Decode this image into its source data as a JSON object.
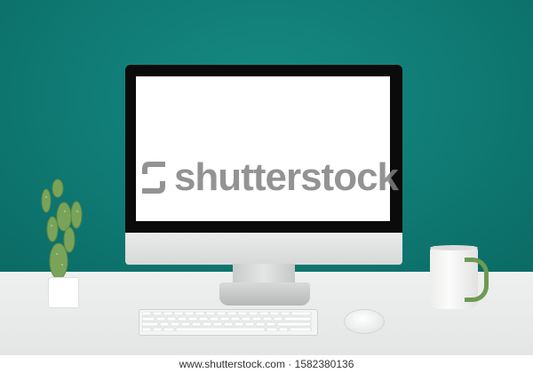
{
  "image": {
    "watermark": "shutterstock",
    "footer_text": "www.shutterstock.com · 1582380136"
  },
  "colors": {
    "wall": "#0f7a73",
    "desk": "#e9ebea",
    "screen": "#ffffff",
    "cactus": "#7aa35a",
    "mug_handle": "#6f9a52"
  }
}
